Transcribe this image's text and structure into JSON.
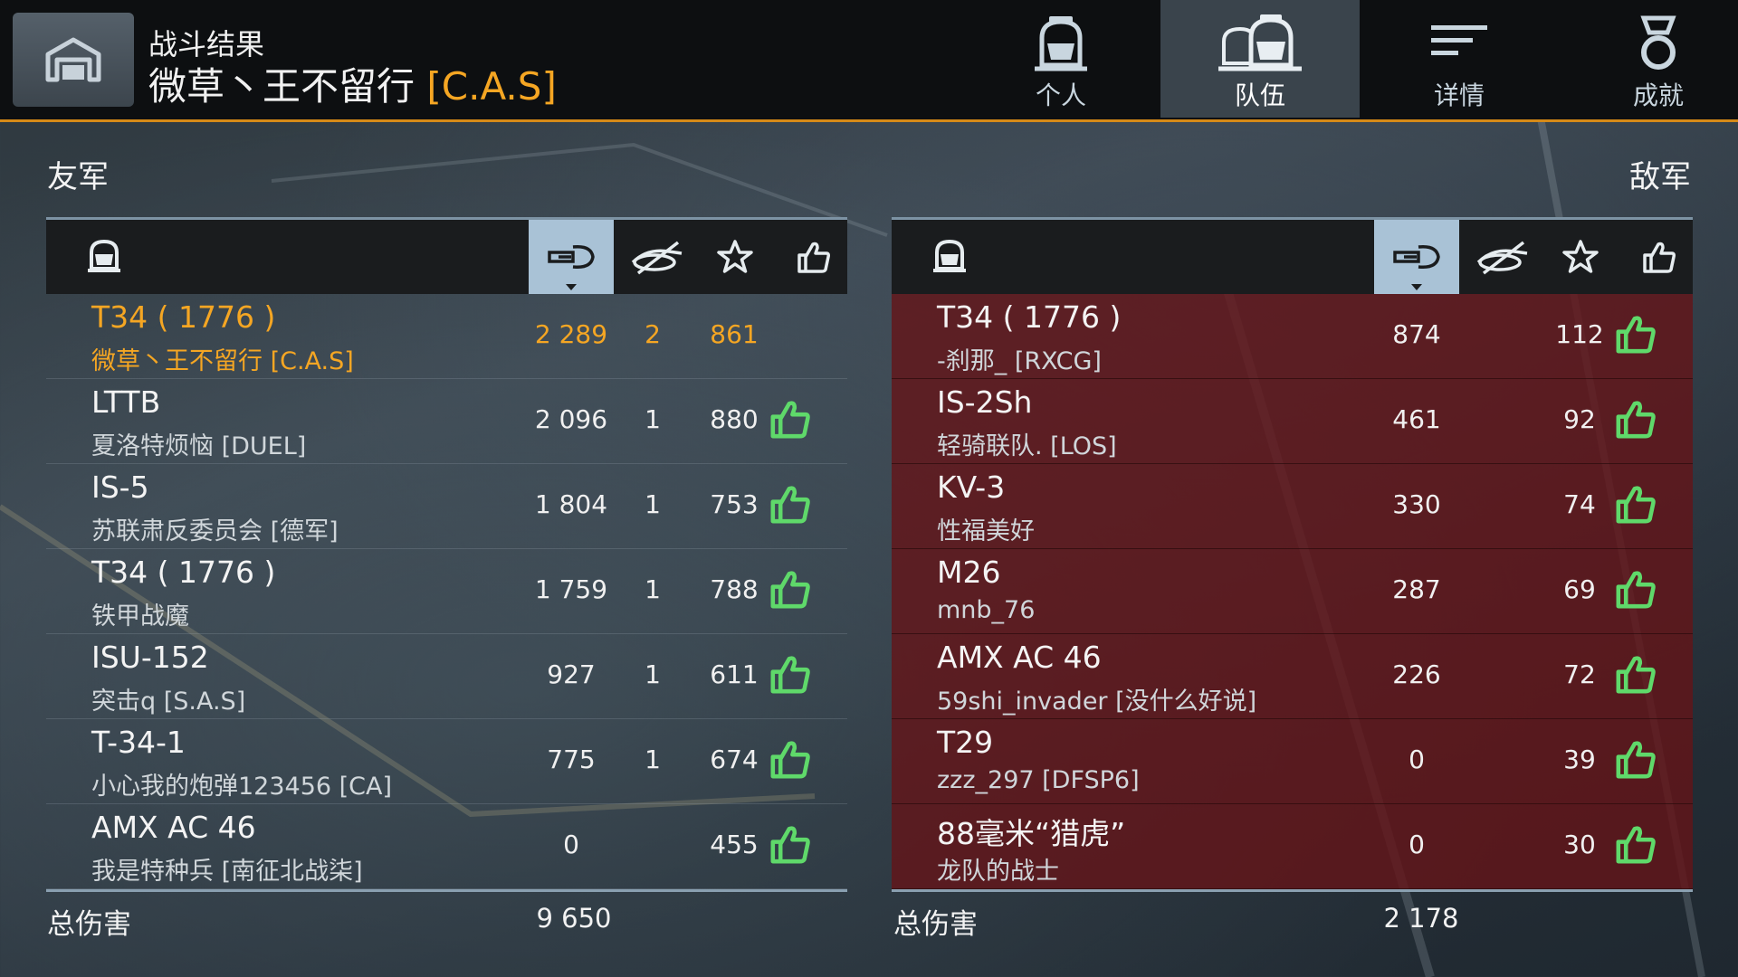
{
  "header": {
    "subtitle": "战斗结果",
    "player_name": "微草丶王不留行",
    "player_clan": "[C.A.S]"
  },
  "tabs": [
    {
      "label": "个人",
      "icon": "single-crew-icon",
      "active": false
    },
    {
      "label": "队伍",
      "icon": "team-crew-icon",
      "active": true
    },
    {
      "label": "详情",
      "icon": "details-lines-icon",
      "active": false
    },
    {
      "label": "成就",
      "icon": "medal-icon",
      "active": false
    }
  ],
  "allies": {
    "label": "友军",
    "columns": [
      "tank-icon",
      "damage-icon",
      "kills-icon",
      "star-icon",
      "like-icon"
    ],
    "rows": [
      {
        "tank": "T34 ( 1776 )",
        "player": "微草丶王不留行 [C.A.S]",
        "damage": "2 289",
        "kills": "2",
        "score": "861",
        "like": false,
        "me": true
      },
      {
        "tank": "LTTB",
        "player": "夏洛特烦恼 [DUEL]",
        "damage": "2 096",
        "kills": "1",
        "score": "880",
        "like": true
      },
      {
        "tank": "IS-5",
        "player": "苏联肃反委员会 [德军]",
        "damage": "1 804",
        "kills": "1",
        "score": "753",
        "like": true
      },
      {
        "tank": "T34 ( 1776 )",
        "player": "铁甲战魔",
        "damage": "1 759",
        "kills": "1",
        "score": "788",
        "like": true
      },
      {
        "tank": "ISU-152",
        "player": "突击q [S.A.S]",
        "damage": "927",
        "kills": "1",
        "score": "611",
        "like": true
      },
      {
        "tank": "T-34-1",
        "player": "小心我的炮弹123456 [CA]",
        "damage": "775",
        "kills": "1",
        "score": "674",
        "like": true
      },
      {
        "tank": "AMX AC 46",
        "player": "我是特种兵 [南征北战柒]",
        "damage": "0",
        "kills": "",
        "score": "455",
        "like": true
      }
    ],
    "total_label": "总伤害",
    "total_damage": "9 650"
  },
  "enemies": {
    "label": "敌军",
    "rows": [
      {
        "tank": "T34 ( 1776 )",
        "player": "-刹那_ [RXCG]",
        "damage": "874",
        "kills": "",
        "score": "112",
        "like": true
      },
      {
        "tank": "IS-2Sh",
        "player": "轻骑联队. [LOS]",
        "damage": "461",
        "kills": "",
        "score": "92",
        "like": true
      },
      {
        "tank": "KV-3",
        "player": "性福美好",
        "damage": "330",
        "kills": "",
        "score": "74",
        "like": true
      },
      {
        "tank": "M26",
        "player": "mnb_76",
        "damage": "287",
        "kills": "",
        "score": "69",
        "like": true
      },
      {
        "tank": "AMX AC 46",
        "player": "59shi_invader [没什么好说]",
        "damage": "226",
        "kills": "",
        "score": "72",
        "like": true
      },
      {
        "tank": "T29",
        "player": "zzz_297 [DFSP6]",
        "damage": "0",
        "kills": "",
        "score": "39",
        "like": true
      },
      {
        "tank": "88毫米“猎虎”",
        "player": "龙队的战士",
        "damage": "0",
        "kills": "",
        "score": "30",
        "like": true
      }
    ],
    "total_label": "总伤害",
    "total_damage": "2 178"
  },
  "colors": {
    "accent": "#f5a623",
    "like_green": "#5fd96a",
    "enemy_row": "#641418",
    "header_sel": "#a9c2d6"
  }
}
